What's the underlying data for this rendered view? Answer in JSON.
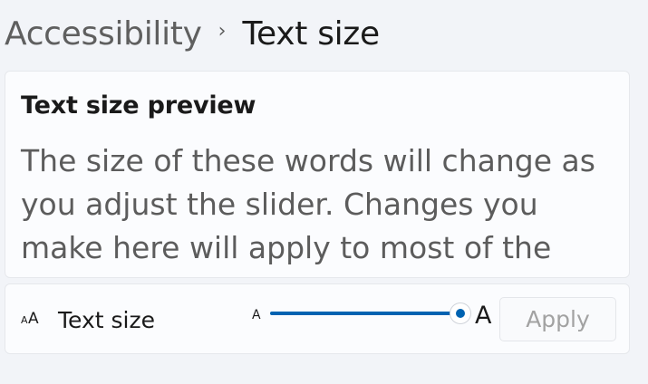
{
  "breadcrumb": {
    "parent": "Accessibility",
    "separator": "›",
    "current": "Text size"
  },
  "preview": {
    "title": "Text size preview",
    "body": "The size of these words will change as you adjust the slider. Changes you make here will apply to most of the text on"
  },
  "text_size": {
    "icon": "text-size-icon",
    "label": "Text size",
    "slider_min_label": "A",
    "slider_max_label": "A",
    "slider_value_fraction": 1.0,
    "apply_label": "Apply",
    "apply_enabled": false
  },
  "colors": {
    "accent": "#0063b1",
    "background": "#f2f4f8",
    "card": "#fbfcfe",
    "disabled_text": "#a2a2a2"
  }
}
